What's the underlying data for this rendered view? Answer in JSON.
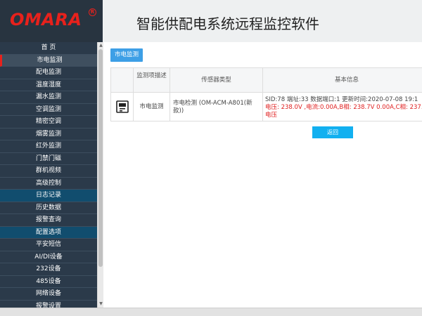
{
  "header": {
    "logo": "OMARA",
    "logo_mark": "R",
    "title": "智能供配电系统远程监控软件"
  },
  "sidebar": {
    "items": [
      {
        "label": "首 页",
        "state": "normal"
      },
      {
        "label": "市电监测",
        "state": "active"
      },
      {
        "label": "配电监测",
        "state": "normal"
      },
      {
        "label": "温度湿度",
        "state": "normal"
      },
      {
        "label": "漏水监测",
        "state": "normal"
      },
      {
        "label": "空调监测",
        "state": "normal"
      },
      {
        "label": "精密空调",
        "state": "normal"
      },
      {
        "label": "烟雾监测",
        "state": "normal"
      },
      {
        "label": "红外监测",
        "state": "normal"
      },
      {
        "label": "门禁门磁",
        "state": "normal"
      },
      {
        "label": "群机视频",
        "state": "normal"
      },
      {
        "label": "高级控制",
        "state": "normal"
      },
      {
        "label": "日志记录",
        "state": "section"
      },
      {
        "label": "历史数据",
        "state": "normal"
      },
      {
        "label": "报警查询",
        "state": "normal"
      },
      {
        "label": "配置选项",
        "state": "section"
      },
      {
        "label": "平安短信",
        "state": "normal"
      },
      {
        "label": "AI/DI设备",
        "state": "normal"
      },
      {
        "label": "232设备",
        "state": "normal"
      },
      {
        "label": "485设备",
        "state": "normal"
      },
      {
        "label": "网络设备",
        "state": "normal"
      },
      {
        "label": "报警设置",
        "state": "normal"
      }
    ]
  },
  "main": {
    "tab_label": "市电监测",
    "table": {
      "headers": [
        "监测项描述",
        "传感器类型",
        "基本信息"
      ],
      "row": {
        "description": "市电监测",
        "sensor_type": "市电检测 (OM-ACM-A801(新款))",
        "info_line1": "SID:78  端址:33  数据端口:1  更新时间:2020-07-08 19:1",
        "info_line2": "电压: 238.0V ,电流:0.00A,B相: 238.7V 0.00A,C相: 237.",
        "info_line3": "电压"
      }
    },
    "back_button": "返回"
  },
  "colors": {
    "logo_red": "#e8211c",
    "sidebar_bg": "#2b3a4a",
    "section_bg": "#114d6e",
    "tab_blue": "#3d9fe6",
    "button_blue": "#12b0f0",
    "alert_red": "#e02020"
  }
}
